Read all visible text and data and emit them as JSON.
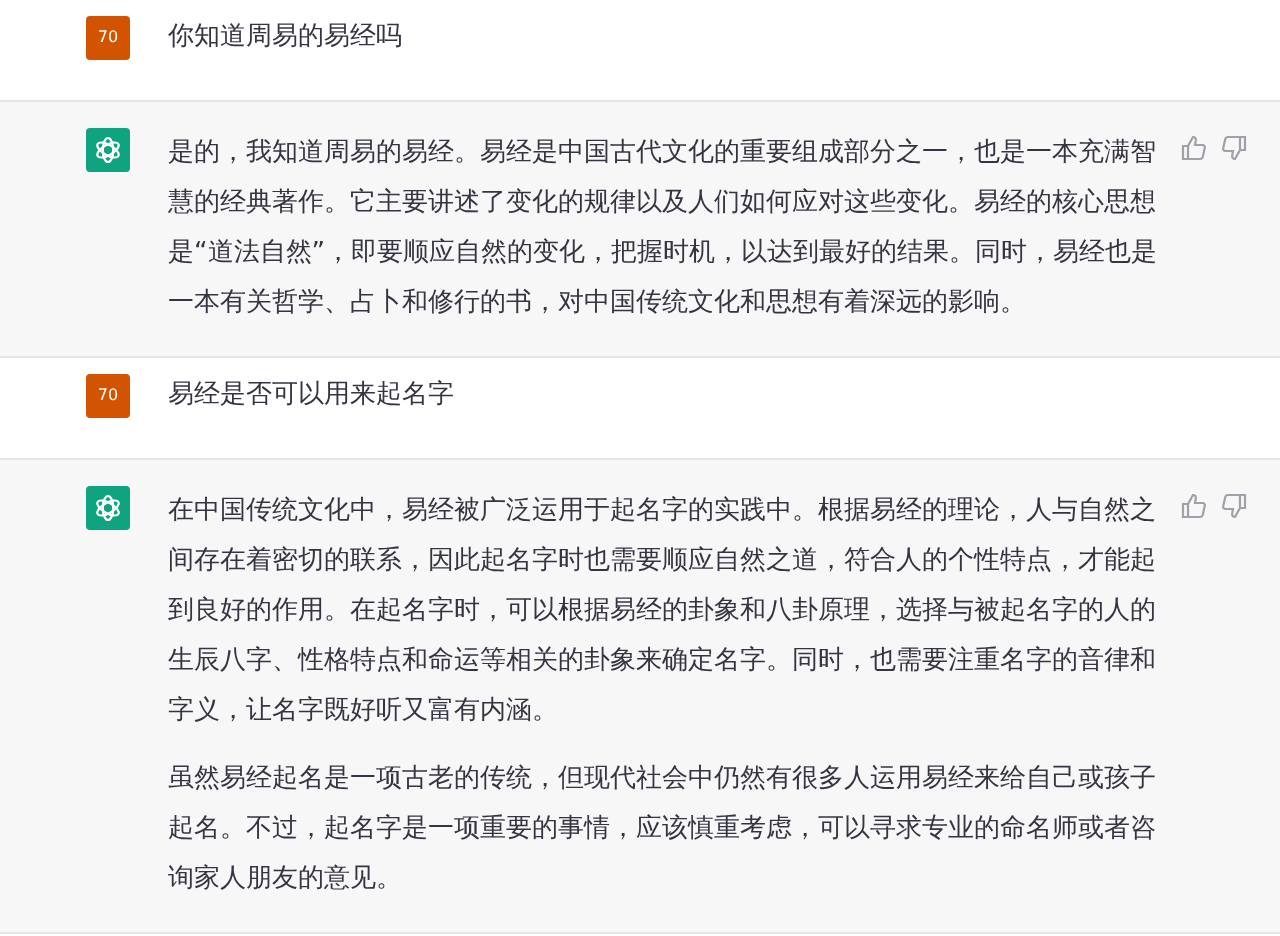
{
  "messages": [
    {
      "kind": "user",
      "avatar": "70",
      "paragraphs": [
        "你知道周易的易经吗"
      ]
    },
    {
      "kind": "assistant",
      "paragraphs": [
        "是的，我知道周易的易经。易经是中国古代文化的重要组成部分之一，也是一本充满智慧的经典著作。它主要讲述了变化的规律以及人们如何应对这些变化。易经的核心思想是“道法自然”，即要顺应自然的变化，把握时机，以达到最好的结果。同时，易经也是一本有关哲学、占卜和修行的书，对中国传统文化和思想有着深远的影响。"
      ]
    },
    {
      "kind": "user",
      "avatar": "70",
      "paragraphs": [
        "易经是否可以用来起名字"
      ]
    },
    {
      "kind": "assistant",
      "paragraphs": [
        "在中国传统文化中，易经被广泛运用于起名字的实践中。根据易经的理论，人与自然之间存在着密切的联系，因此起名字时也需要顺应自然之道，符合人的个性特点，才能起到良好的作用。在起名字时，可以根据易经的卦象和八卦原理，选择与被起名字的人的生辰八字、性格特点和命运等相关的卦象来确定名字。同时，也需要注重名字的音律和字义，让名字既好听又富有内涵。",
        "虽然易经起名是一项古老的传统，但现代社会中仍然有很多人运用易经来给自己或孩子起名。不过，起名字是一项重要的事情，应该慎重考虑，可以寻求专业的命名师或者咨询家人朋友的意见。"
      ]
    }
  ]
}
